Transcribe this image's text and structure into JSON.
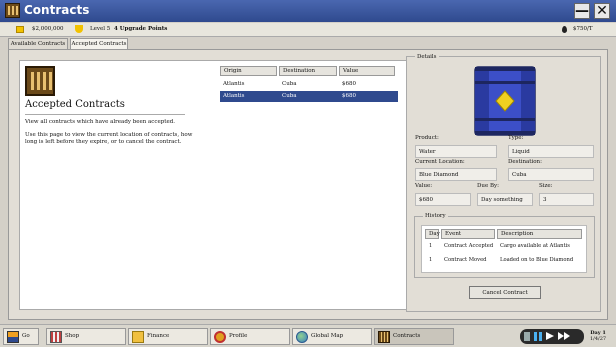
{
  "window": {
    "title": "Contracts",
    "minimize_label": "—",
    "close_label": "✕"
  },
  "status": {
    "money": "$2,000,000",
    "level": "Level 5",
    "upgrade_points": "4 Upgrade Points",
    "oil_price": "$750/T"
  },
  "tabs": [
    {
      "label": "Available Contracts"
    },
    {
      "label": "Accepted Contracts"
    }
  ],
  "page": {
    "heading": "Accepted Contracts",
    "description": "View all contracts which have already been accepted.",
    "help": "Use this page to view the current location of contracts, how long is left before they expire, or to cancel the contract."
  },
  "contracts": {
    "columns": [
      "Origin",
      "Destination",
      "Value"
    ],
    "rows": [
      {
        "origin": "Atlantis",
        "destination": "Cuba",
        "value": "$680"
      },
      {
        "origin": "Atlantis",
        "destination": "Cuba",
        "value": "$680"
      }
    ]
  },
  "details": {
    "title": "Details",
    "product_label": "Product:",
    "product": "Water",
    "type_label": "Type:",
    "type": "Liquid",
    "location_label": "Current Location:",
    "location": "Blue Diamond",
    "destination_label": "Destination:",
    "destination": "Cuba",
    "value_label": "Value:",
    "value": "$680",
    "dueby_label": "Due By:",
    "dueby": "Day something",
    "size_label": "Size:",
    "size": "3",
    "history_title": "History",
    "history_columns": [
      "Day",
      "Event",
      "Description"
    ],
    "history": [
      {
        "day": "1",
        "event": "Contract Accepted",
        "description": "Cargo available at Atlantis"
      },
      {
        "day": "1",
        "event": "Contract Moved",
        "description": "Loaded on to Blue Diamond"
      }
    ],
    "cancel_label": "Cancel Contract"
  },
  "taskbar": {
    "go": "Go",
    "shop": "Shop",
    "finance": "Finance",
    "profile": "Profile",
    "global_map": "Global Map",
    "contracts": "Contracts",
    "day": "Day 1",
    "date": "1/4/27"
  },
  "colors": {
    "titlebar": "#3a5aa8",
    "selection": "#2f4a8e",
    "barrel": "#3c4fc8",
    "diamond": "#f0d020"
  }
}
